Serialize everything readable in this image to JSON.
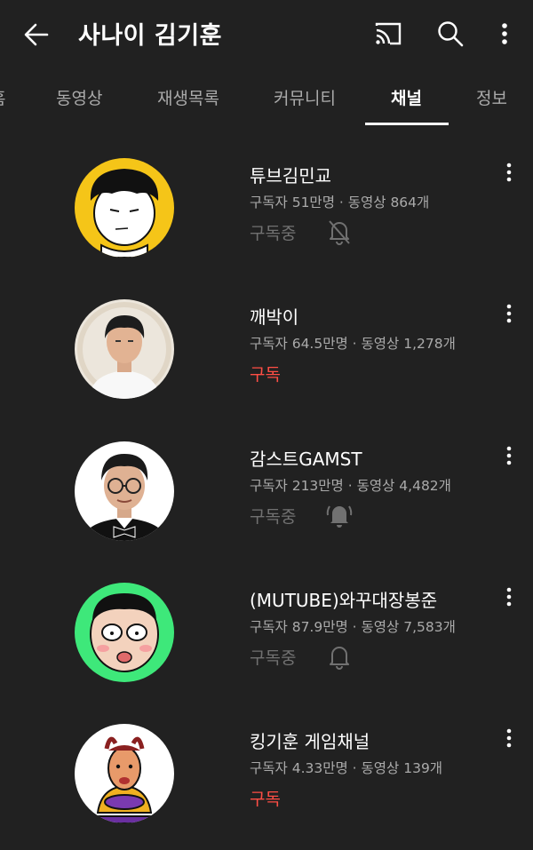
{
  "header": {
    "title": "사나이 김기훈"
  },
  "tabs": [
    {
      "label": "홈"
    },
    {
      "label": "동영상"
    },
    {
      "label": "재생목록"
    },
    {
      "label": "커뮤니티"
    },
    {
      "label": "채널"
    },
    {
      "label": "정보"
    }
  ],
  "active_tab": "채널",
  "channels": [
    {
      "name": "튜브김민교",
      "stats": "구독자 51만명 · 동영상 864개",
      "subscription": "구독중",
      "bell": "off"
    },
    {
      "name": "깨박이",
      "stats": "구독자 64.5만명 · 동영상 1,278개",
      "subscription": "구독",
      "bell": "none"
    },
    {
      "name": "감스트GAMST",
      "stats": "구독자 213만명 · 동영상 4,482개",
      "subscription": "구독중",
      "bell": "all"
    },
    {
      "name": "(MUTUBE)와꾸대장봉준",
      "stats": "구독자 87.9만명 · 동영상 7,583개",
      "subscription": "구독중",
      "bell": "personalized"
    },
    {
      "name": "킹기훈 게임채널",
      "stats": "구독자 4.33만명 · 동영상 139개",
      "subscription": "구독",
      "bell": "none"
    }
  ],
  "colors": {
    "background": "#212121",
    "subscribe_red": "#ff4e45",
    "subscribed_gray": "#717171"
  }
}
